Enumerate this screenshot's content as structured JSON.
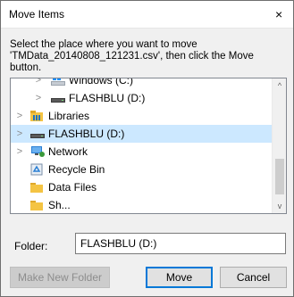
{
  "dialog": {
    "title": "Move Items",
    "close_glyph": "×",
    "instructions": "Select the place where you want to move 'TMData_20140808_121231.csv', then click the Move button."
  },
  "tree": {
    "items": [
      {
        "label": "Windows (C:)",
        "icon": "windows-drive-icon",
        "chevron": ">",
        "selected": false
      },
      {
        "label": "FLASHBLU (D:)",
        "icon": "usb-drive-icon",
        "chevron": ">",
        "selected": false
      },
      {
        "label": "Libraries",
        "icon": "libraries-icon",
        "chevron": ">",
        "selected": false
      },
      {
        "label": "FLASHBLU (D:)",
        "icon": "usb-drive-icon",
        "chevron": ">",
        "selected": true
      },
      {
        "label": "Network",
        "icon": "network-icon",
        "chevron": ">",
        "selected": false
      },
      {
        "label": "Recycle Bin",
        "icon": "recycle-bin-icon",
        "chevron": "",
        "selected": false
      },
      {
        "label": "Data Files",
        "icon": "folder-icon",
        "chevron": "",
        "selected": false
      },
      {
        "label": "Sh...",
        "icon": "folder-icon",
        "chevron": "",
        "selected": false
      }
    ],
    "scroll_up": "^",
    "scroll_down": "v"
  },
  "folder": {
    "label": "Folder:",
    "value": "FLASHBLU (D:)"
  },
  "buttons": {
    "make_new_folder": "Make New Folder",
    "move": "Move",
    "cancel": "Cancel"
  },
  "colors": {
    "selection": "#cce8ff",
    "accent": "#0078d7",
    "folder_yellow": "#f4c443"
  }
}
